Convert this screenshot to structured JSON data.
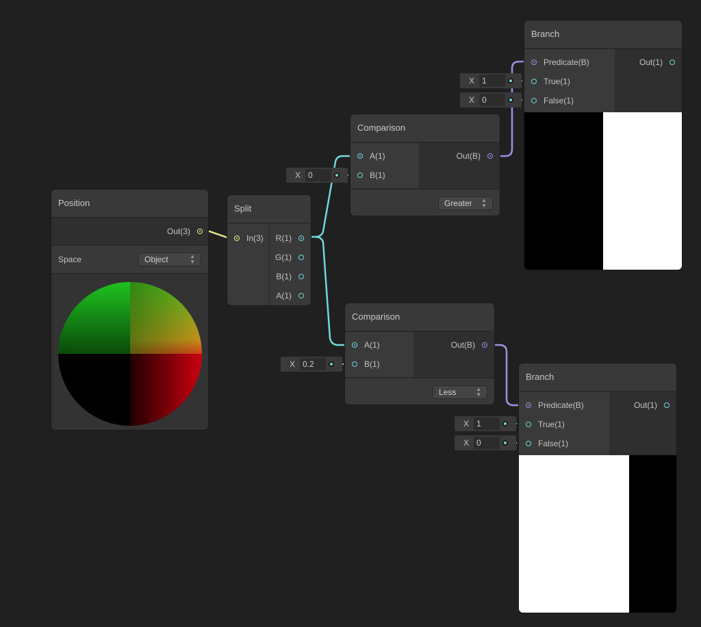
{
  "colors": {
    "background": "#202020",
    "node": "#393939",
    "wire_vector3": "#e6ea8a",
    "wire_float": "#6fd8dc",
    "wire_bool": "#a28ee6"
  },
  "nodes": {
    "position": {
      "title": "Position",
      "outputs": [
        {
          "label": "Out(3)",
          "type": "vector3",
          "connected": true
        }
      ],
      "space_label": "Space",
      "space_value": "Object",
      "preview": "sphere-position-gradient"
    },
    "split": {
      "title": "Split",
      "inputs": [
        {
          "label": "In(3)",
          "type": "vector3",
          "connected": true
        }
      ],
      "outputs": [
        {
          "label": "R(1)",
          "connected": true
        },
        {
          "label": "G(1)",
          "connected": false
        },
        {
          "label": "B(1)",
          "connected": false
        },
        {
          "label": "A(1)",
          "connected": false
        }
      ]
    },
    "comparison_top": {
      "title": "Comparison",
      "inputs": [
        {
          "label": "A(1)",
          "connected": true
        },
        {
          "label": "B(1)",
          "connected": true
        }
      ],
      "outputs": [
        {
          "label": "Out(B)",
          "connected": true
        }
      ],
      "mode": "Greater",
      "b_value": {
        "axis": "X",
        "value": "0"
      }
    },
    "comparison_bottom": {
      "title": "Comparison",
      "inputs": [
        {
          "label": "A(1)",
          "connected": true
        },
        {
          "label": "B(1)",
          "connected": true
        }
      ],
      "outputs": [
        {
          "label": "Out(B)",
          "connected": true
        }
      ],
      "mode": "Less",
      "b_value": {
        "axis": "X",
        "value": "0.2"
      }
    },
    "branch_top": {
      "title": "Branch",
      "inputs": [
        {
          "label": "Predicate(B)",
          "connected": true
        },
        {
          "label": "True(1)",
          "connected": true
        },
        {
          "label": "False(1)",
          "connected": true
        }
      ],
      "outputs": [
        {
          "label": "Out(1)",
          "connected": false
        }
      ],
      "true_value": {
        "axis": "X",
        "value": "1"
      },
      "false_value": {
        "axis": "X",
        "value": "0"
      },
      "preview": "black-left-white-right"
    },
    "branch_bottom": {
      "title": "Branch",
      "inputs": [
        {
          "label": "Predicate(B)",
          "connected": true
        },
        {
          "label": "True(1)",
          "connected": true
        },
        {
          "label": "False(1)",
          "connected": true
        }
      ],
      "outputs": [
        {
          "label": "Out(1)",
          "connected": false
        }
      ],
      "true_value": {
        "axis": "X",
        "value": "1"
      },
      "false_value": {
        "axis": "X",
        "value": "0"
      },
      "preview": "white-left-black-right"
    }
  },
  "icons": {
    "dropdown_arrows": "▲\n▼"
  }
}
